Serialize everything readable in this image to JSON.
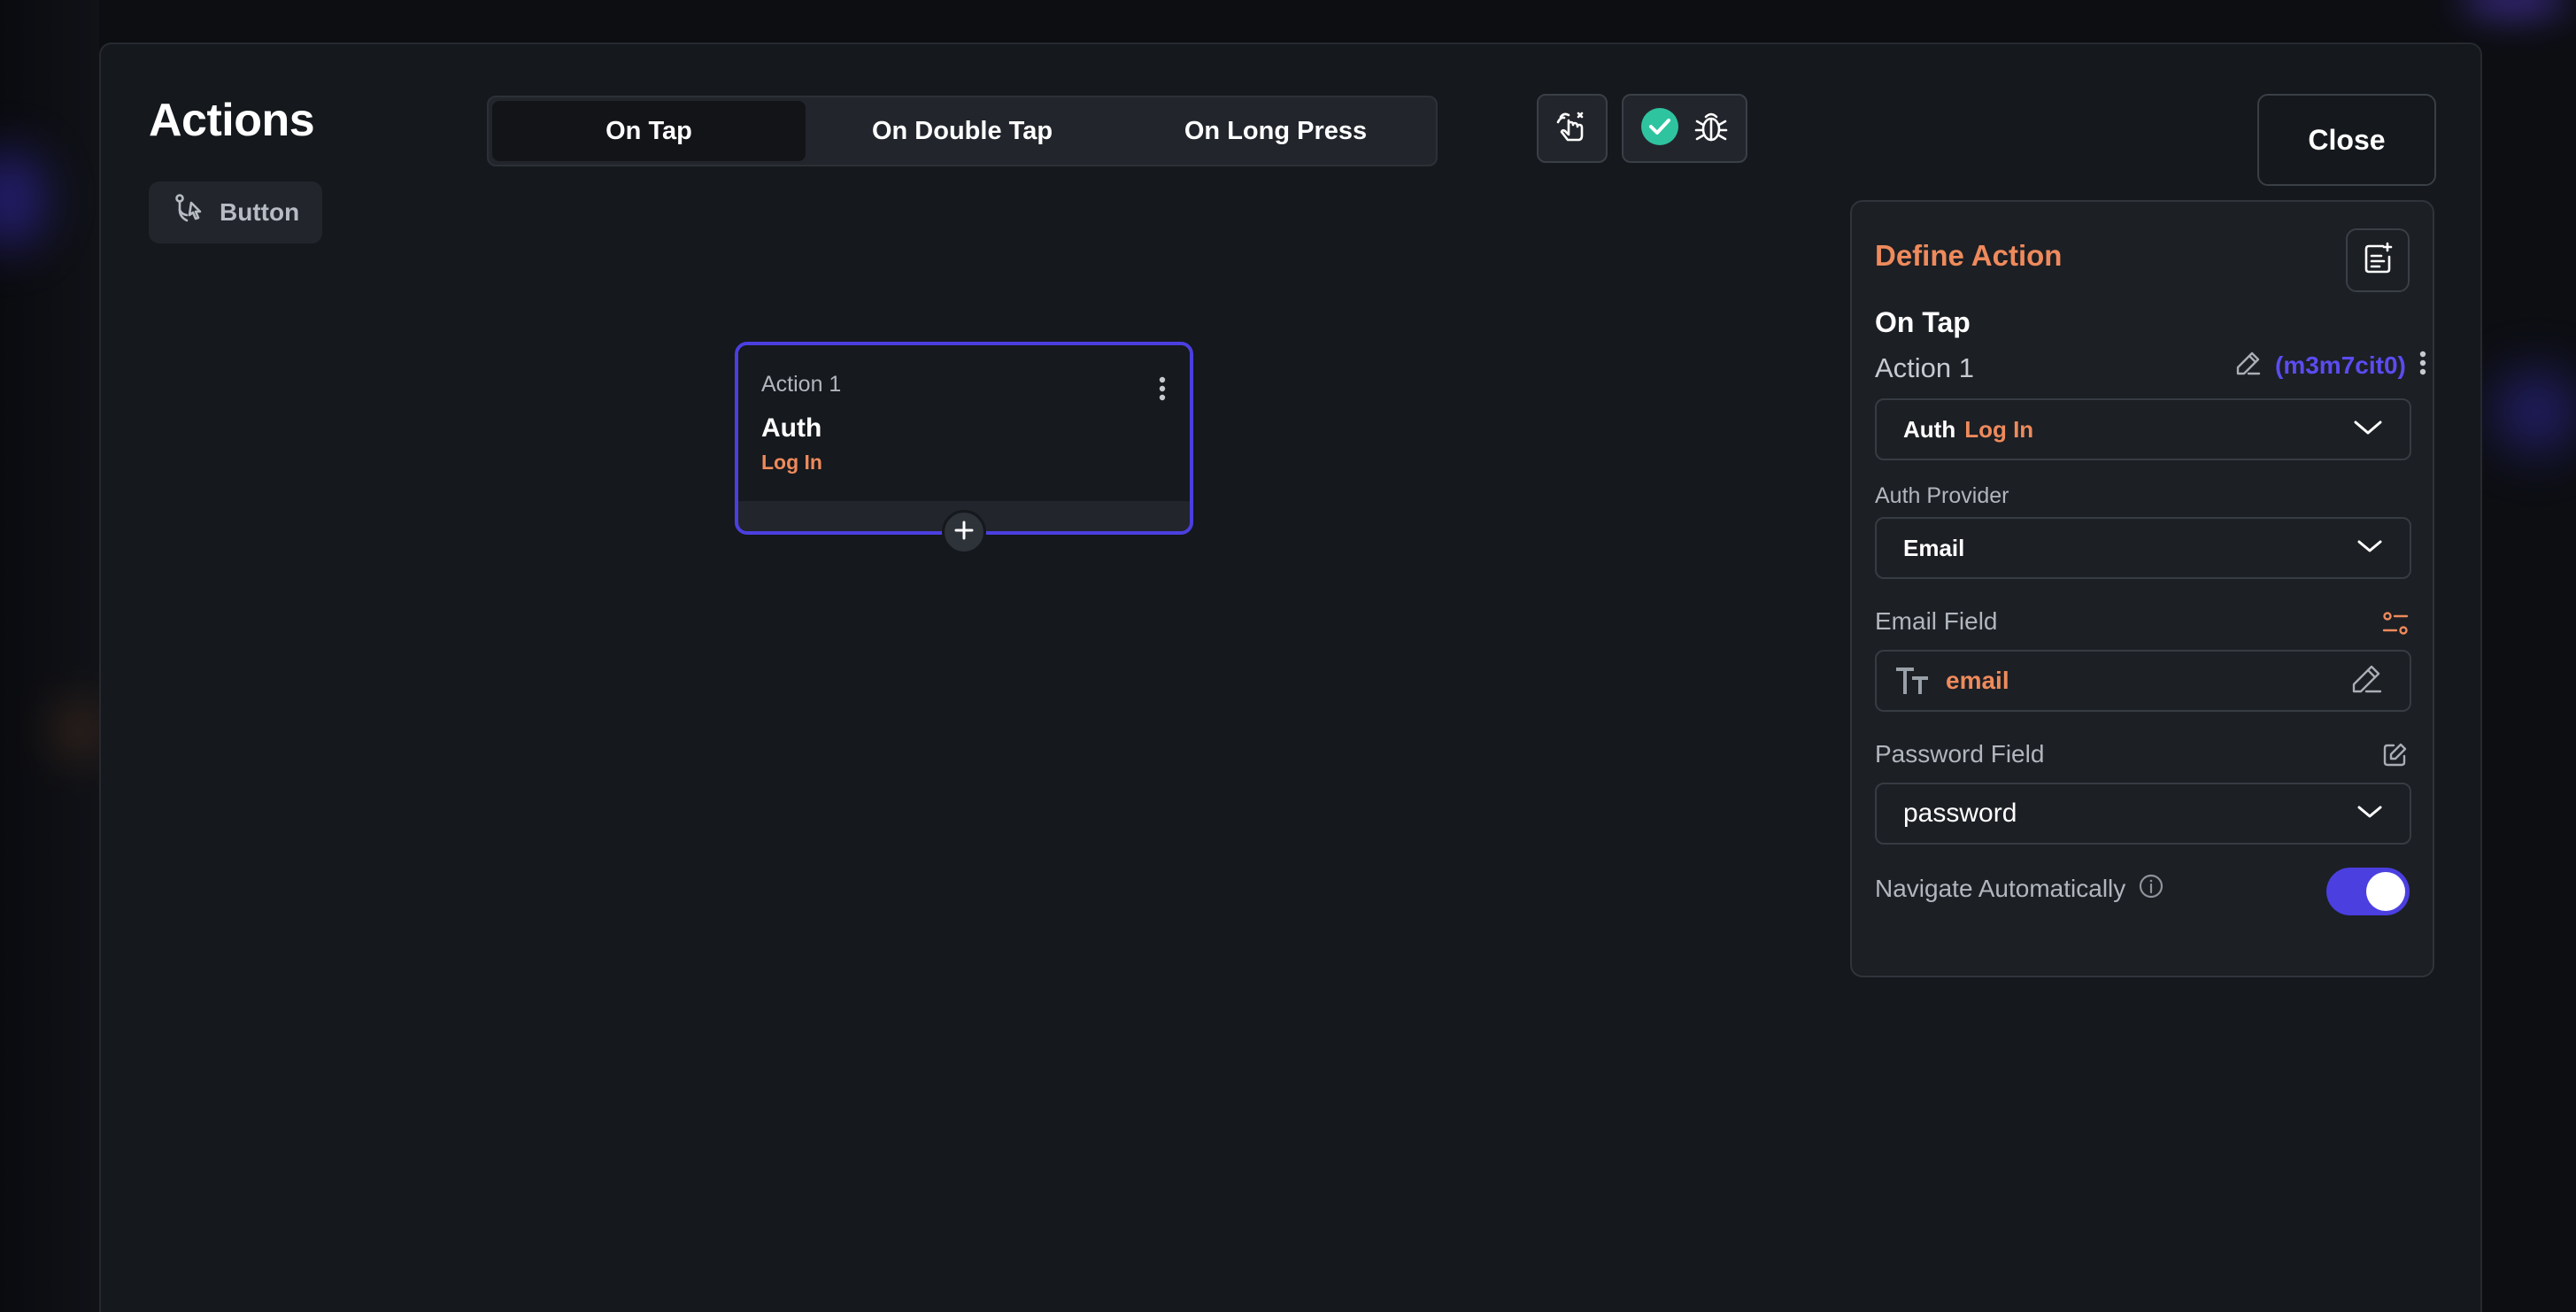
{
  "header": {
    "title": "Actions",
    "close_label": "Close"
  },
  "widget_chip": {
    "label": "Button",
    "icon": "flow-branch-icon"
  },
  "tabs": [
    {
      "label": "On Tap",
      "active": true
    },
    {
      "label": "On Double Tap",
      "active": false
    },
    {
      "label": "On Long Press",
      "active": false
    }
  ],
  "toolbar": {
    "tools": [
      "gesture-hand-icon",
      "check-circle-icon",
      "bug-icon"
    ]
  },
  "action_node": {
    "label": "Action 1",
    "title": "Auth",
    "subtitle": "Log In"
  },
  "panel": {
    "title": "Define Action",
    "trigger": "On Tap",
    "action_name": "Action 1",
    "action_id": "(m3m7cit0)",
    "action_type": {
      "category": "Auth",
      "action": "Log In"
    },
    "auth_provider": {
      "label": "Auth Provider",
      "value": "Email"
    },
    "email_field": {
      "label": "Email Field",
      "value": "email"
    },
    "password_field": {
      "label": "Password Field",
      "value": "password"
    },
    "navigate_automatically": {
      "label": "Navigate Automatically",
      "enabled": true
    }
  },
  "colors": {
    "accent": "#4b3fe0",
    "orange": "#ee8a5c",
    "success": "#2ec4a0",
    "background": "#15181c"
  }
}
